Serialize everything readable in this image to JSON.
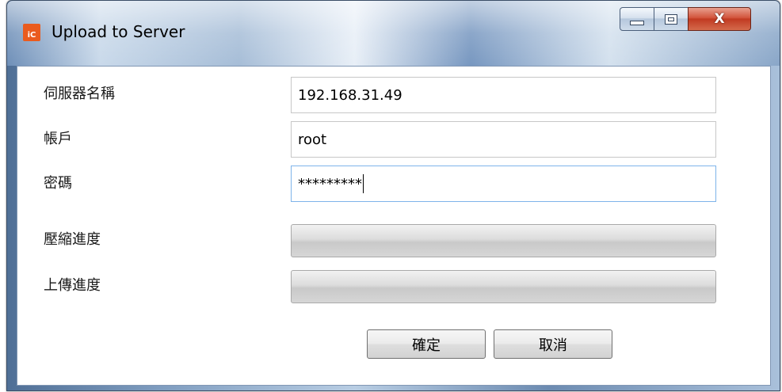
{
  "window": {
    "title": "Upload to Server",
    "icon_text": "iC",
    "close_glyph": "X"
  },
  "form": {
    "server_name": {
      "label": "伺服器名稱",
      "value": "192.168.31.49"
    },
    "account": {
      "label": "帳戶",
      "value": "root"
    },
    "password": {
      "label": "密碼",
      "value": "*********"
    },
    "compress_progress": {
      "label": "壓縮進度",
      "value_percent": 0
    },
    "upload_progress": {
      "label": "上傳進度",
      "value_percent": 0
    }
  },
  "buttons": {
    "ok": "確定",
    "cancel": "取消"
  }
}
